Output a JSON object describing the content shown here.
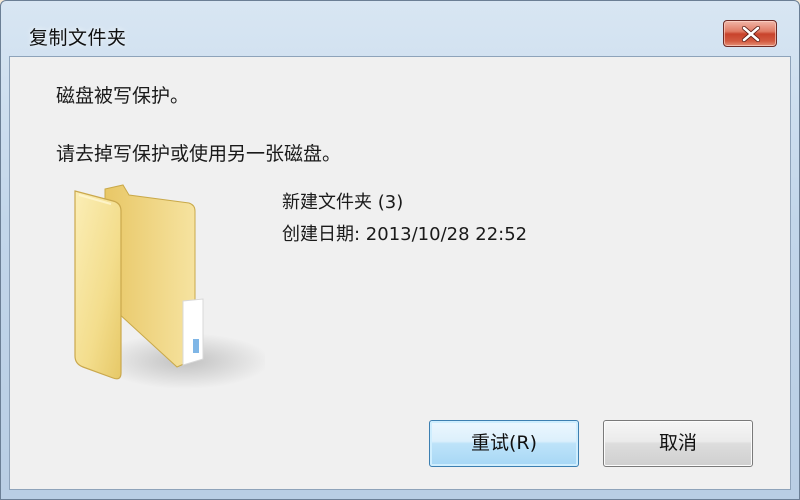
{
  "window": {
    "title": "复制文件夹"
  },
  "message": {
    "line1": "磁盘被写保护。",
    "line2": "请去掉写保护或使用另一张磁盘。"
  },
  "file": {
    "icon": "folder-icon",
    "name": "新建文件夹 (3)",
    "date_line": "创建日期: 2013/10/28 22:52"
  },
  "buttons": {
    "retry": "重试(R)",
    "cancel": "取消"
  },
  "colors": {
    "close_button": "#c8432c",
    "default_button_border": "#3c7fb1",
    "folder": "#f3dd8c"
  }
}
